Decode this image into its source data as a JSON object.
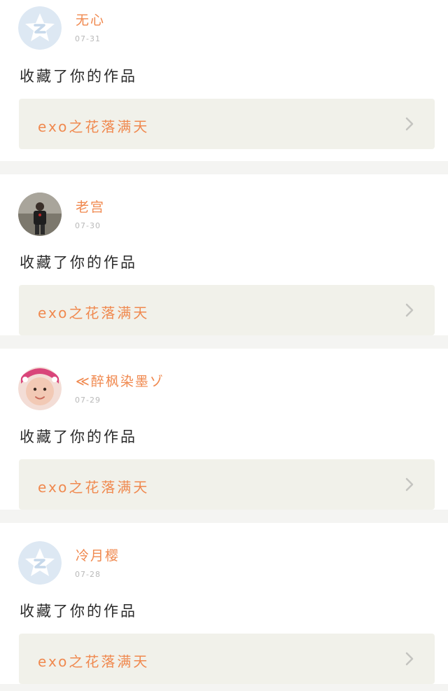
{
  "activity": [
    {
      "username": "无心",
      "date": "07-31",
      "action": "收藏了你的作品",
      "work_title": "exo之花落满天",
      "avatar": "qq-star-default-icon"
    },
    {
      "username": "老宫",
      "date": "07-30",
      "action": "收藏了你的作品",
      "work_title": "exo之花落满天",
      "avatar": "person-photo"
    },
    {
      "username": "≪醉枫染墨ゾ",
      "date": "07-29",
      "action": "收藏了你的作品",
      "work_title": "exo之花落满天",
      "avatar": "baby-photo"
    },
    {
      "username": "冷月樱",
      "date": "07-28",
      "action": "收藏了你的作品",
      "work_title": "exo之花落满天",
      "avatar": "qq-star-default-icon"
    }
  ],
  "colors": {
    "accent": "#f0894f",
    "card_bg": "#ffffff",
    "work_bg": "#f1f1ea",
    "page_bg": "#f4f4f2"
  }
}
